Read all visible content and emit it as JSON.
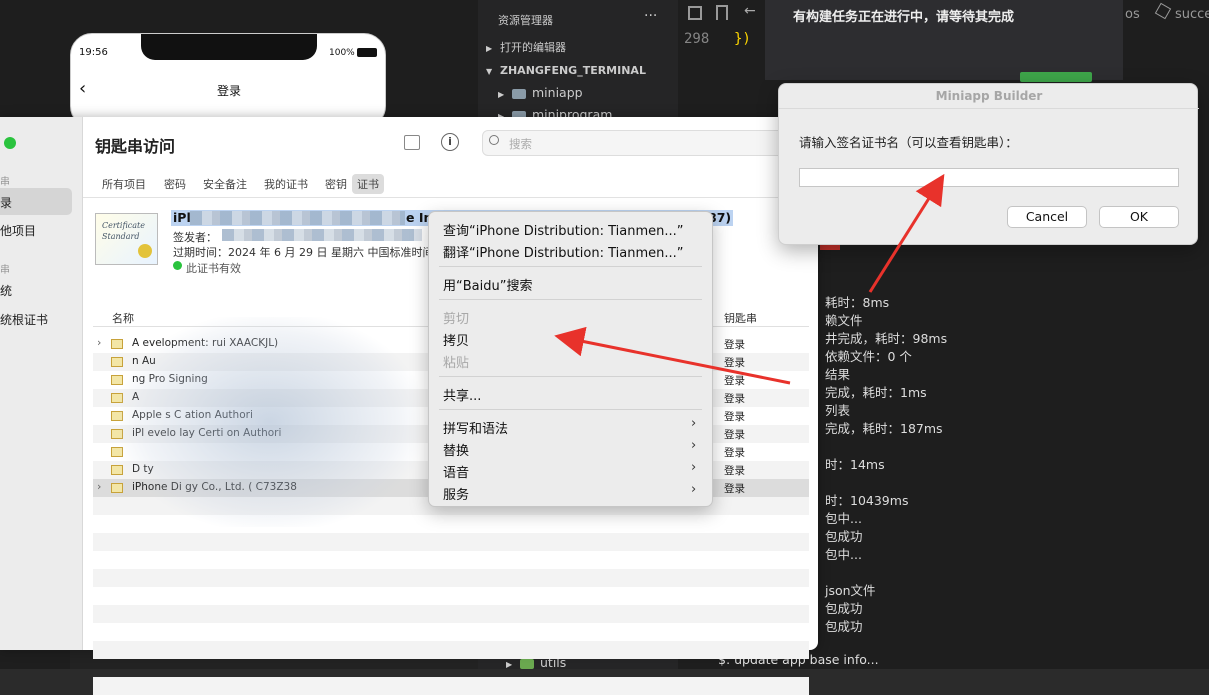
{
  "ide": {
    "explorer_title": "资源管理器",
    "more_label": "···",
    "open_editors": "打开的编辑器",
    "workspace": "ZHANGFENG_TERMINAL",
    "folder1": "miniapp",
    "folder2": "miniprogram",
    "folder3": "utils",
    "line_number": "298",
    "code_fragment": "})",
    "breadcrumb": "os",
    "breadcrumb2": "succe",
    "notice": "有构建任务正在进行中，请等待其完成",
    "terminal_lines": [
      "耗时：8ms",
      "赖文件",
      "井完成，耗时：98ms",
      "依赖文件：0 个",
      "结果",
      "完成，耗时：1ms",
      "列表",
      "完成，耗时：187ms",
      "",
      "时：14ms",
      "",
      "时：10439ms",
      "包中...",
      "包成功",
      "包中...",
      "",
      "json文件",
      "包成功",
      "包成功"
    ],
    "bottom_line": "$: update app base info..."
  },
  "phone": {
    "time": "19:56",
    "battery": "100%",
    "title": "登录"
  },
  "keychain": {
    "title": "钥匙串访问",
    "search_placeholder": "搜索",
    "sidebar": {
      "section1": "串",
      "item_selected": "录",
      "item2": "他项目",
      "section2": "串",
      "item3": "统",
      "item4": "统根证书"
    },
    "tabs": [
      "所有项目",
      "密码",
      "安全备注",
      "我的证书",
      "密钥",
      "证书"
    ],
    "cert": {
      "name_prefix": "iPl",
      "name_mid": "e In",
      "name_suffix": "87)",
      "issuer_label": "签发者：",
      "expiry": "过期时间：2024 年 6 月 29 日 星期六 中国标准时间",
      "valid": "此证书有效"
    },
    "columns": {
      "name": "名称",
      "keychain": "钥匙串"
    },
    "rows": [
      {
        "name": "A      evelopment: rui        XAACKJL)",
        "keychain": "登录"
      },
      {
        "name": "                n Au         ",
        "keychain": "登录"
      },
      {
        "name": "      ng Pro    Signing",
        "keychain": "登录"
      },
      {
        "name": "    A",
        "keychain": "登录"
      },
      {
        "name": "Apple         s C      ation Authori",
        "keychain": "登录"
      },
      {
        "name": "iPl    evelo     lay    Certi   on Authori",
        "keychain": "登录"
      },
      {
        "name": "         ",
        "keychain": "登录"
      },
      {
        "name": "D               ty",
        "keychain": "登录"
      },
      {
        "name": "iPhone Di           gy Co., Ltd. (     C73Z38",
        "keychain": "登录"
      }
    ],
    "cert_thumb_text": "Certificate Standard"
  },
  "context_menu": {
    "lookup": "查询“iPhone Distribution: Tianmen...”",
    "translate": "翻译“iPhone Distribution: Tianmen...”",
    "search": "用“Baidu”搜索",
    "cut": "剪切",
    "copy": "拷贝",
    "paste": "粘贴",
    "share": "共享...",
    "spelling": "拼写和语法",
    "substitutions": "替换",
    "speech": "语音",
    "services": "服务",
    "chevron": "›"
  },
  "dialog": {
    "title": "Miniapp Builder",
    "prompt": "请输入签名证书名（可以查看钥匙串）：",
    "input_value": "",
    "cancel": "Cancel",
    "ok": "OK"
  },
  "colors": {
    "arrow": "#e8322b",
    "accent_green": "#2ac33e"
  }
}
